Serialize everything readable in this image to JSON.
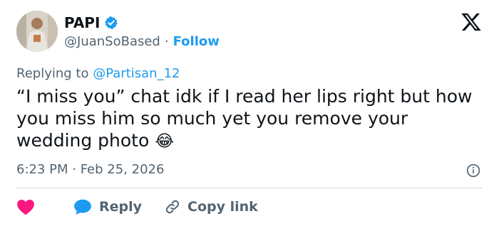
{
  "author": {
    "name": "PAPI",
    "handle": "@JuanSoBased",
    "separator": "·",
    "follow_label": "Follow"
  },
  "reply_context": {
    "prefix": "Replying to",
    "mention": "@Partisan_12"
  },
  "tweet": {
    "text": "“I miss you” chat idk if I read her lips right but how you miss him so much yet you remove your wedding photo",
    "emoji": "😂",
    "timestamp": "6:23 PM · Feb 25, 2026"
  },
  "actions": {
    "reply_label": "Reply",
    "copy_link_label": "Copy link"
  },
  "colors": {
    "accent": "#1d9bf0",
    "like": "#f91880",
    "muted": "#536471",
    "text": "#0f1419"
  },
  "icons": [
    "verified-badge-icon",
    "x-logo-icon",
    "info-icon",
    "heart-icon",
    "reply-bubble-icon",
    "link-icon"
  ]
}
